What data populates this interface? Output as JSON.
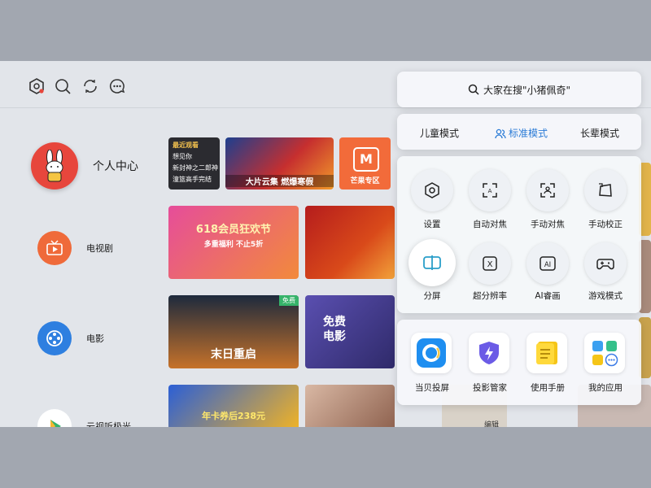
{
  "top_icons": [
    "settings-hex-icon",
    "search-icon",
    "refresh-icon",
    "message-icon"
  ],
  "left_nav": {
    "profile_label": "个人中心",
    "tv_label": "电视剧",
    "movie_label": "电影",
    "cloud_label": "云视听极光"
  },
  "tiles": {
    "recent_title": "最近观看",
    "recent_items": [
      "想见你",
      "新封神之二郎神",
      "潼篮高手完结"
    ],
    "blockbuster": "大片云集 燃爆寒假",
    "mango": "芒果专区",
    "promo_618_title": "618会员狂欢节",
    "promo_618_sub": "多重福利 不止5折",
    "free_tag": "免费",
    "doomsday": "末日重启",
    "free_movie": "免费\n电影",
    "svip": "年卡券后238元",
    "partial_label": "编辑"
  },
  "panel": {
    "search_text": "大家在搜\"小猪佩奇\"",
    "modes": [
      "儿童模式",
      "标准模式",
      "长辈模式"
    ],
    "active_mode_index": 1,
    "quick_row1": [
      "设置",
      "自动对焦",
      "手动对焦",
      "手动校正"
    ],
    "quick_row2": [
      "分屏",
      "超分辨率",
      "AI睿画",
      "游戏模式"
    ],
    "active_quick": "分屏",
    "quick_ai_glyph": "AI",
    "quick_x_glyph": "X",
    "apps": [
      "当贝投屏",
      "投影管家",
      "使用手册",
      "我的应用"
    ]
  },
  "colors": {
    "accent": "#2a7bd6",
    "profile_red": "#e7463c",
    "tv_orange": "#ef6a3a",
    "movie_blue": "#2e7fe0"
  }
}
